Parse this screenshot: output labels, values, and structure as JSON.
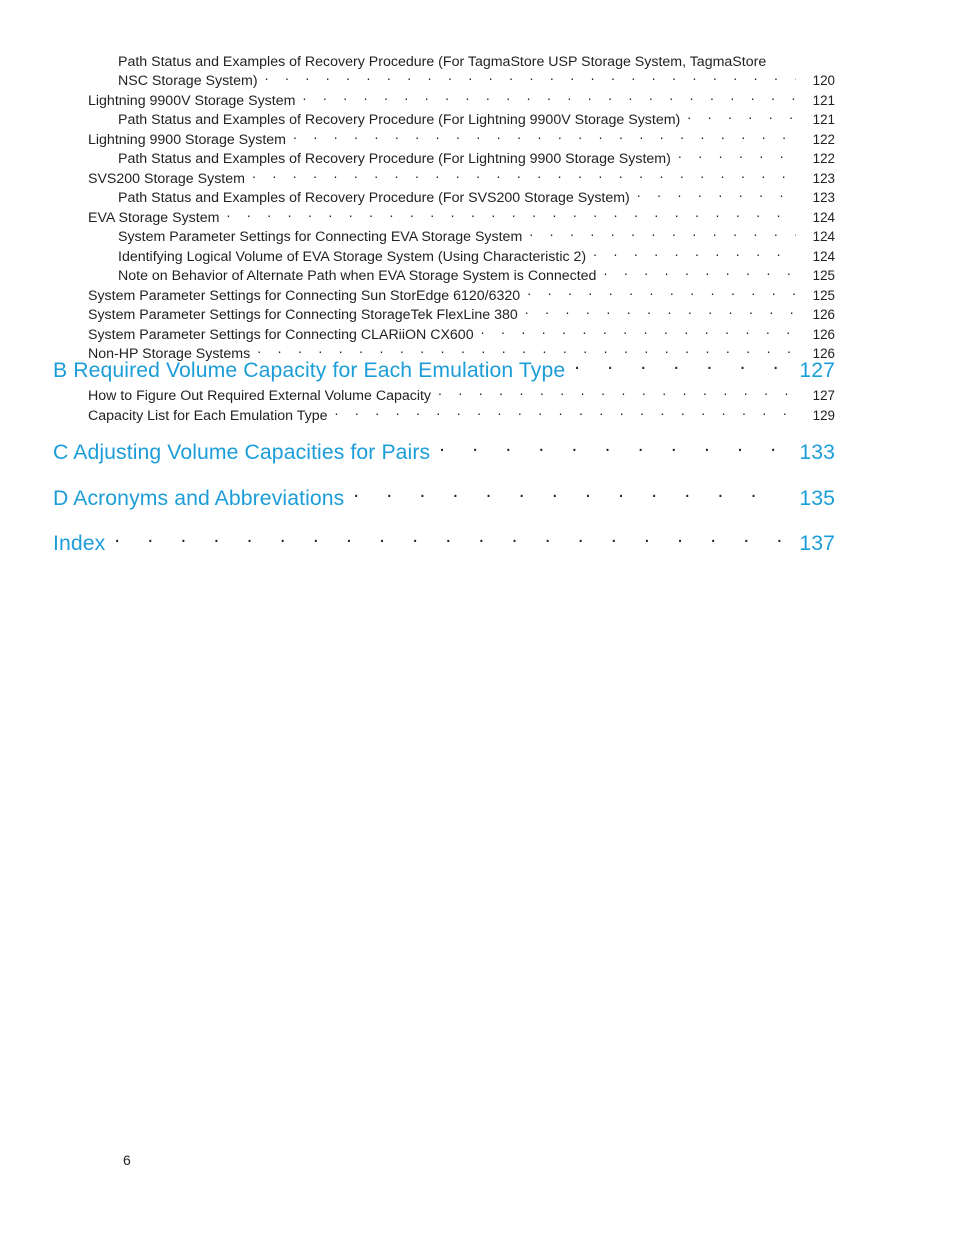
{
  "document": {
    "type": "table-of-contents",
    "footer_page_number": "6",
    "accent_color": "#1b9dd9",
    "text_color": "#221f1f",
    "background_color": "#ffffff"
  },
  "continued_section": {
    "entries": [
      {
        "level": 2,
        "wrapped": true,
        "line1": "Path Status and Examples of Recovery Procedure (For TagmaStore USP Storage System, TagmaStore",
        "title": "NSC Storage System)",
        "page": "120"
      },
      {
        "level": 1,
        "title": "Lightning 9900V Storage System",
        "page": "121"
      },
      {
        "level": 2,
        "title": "Path Status and Examples of Recovery Procedure (For Lightning 9900V Storage System)",
        "page": "121"
      },
      {
        "level": 1,
        "title": "Lightning 9900 Storage System",
        "page": "122"
      },
      {
        "level": 2,
        "title": "Path Status and Examples of Recovery Procedure (For Lightning 9900 Storage System)",
        "page": "122"
      },
      {
        "level": 1,
        "title": "SVS200 Storage System",
        "page": "123"
      },
      {
        "level": 2,
        "title": "Path Status and Examples of Recovery Procedure (For SVS200 Storage System)",
        "page": "123"
      },
      {
        "level": 1,
        "title": "EVA Storage System",
        "page": "124"
      },
      {
        "level": 2,
        "title": "System Parameter Settings for Connecting EVA Storage System",
        "page": "124"
      },
      {
        "level": 2,
        "title": "Identifying Logical Volume of EVA Storage System (Using Characteristic 2)",
        "page": "124"
      },
      {
        "level": 2,
        "title": "Note on Behavior of Alternate Path when EVA Storage System is Connected",
        "page": "125"
      },
      {
        "level": 1,
        "title": "System Parameter Settings for Connecting Sun StorEdge 6120/6320",
        "page": "125"
      },
      {
        "level": 1,
        "title": "System Parameter Settings for Connecting StorageTek FlexLine 380",
        "page": "126"
      },
      {
        "level": 1,
        "title": "System Parameter Settings for Connecting CLARiiON CX600",
        "page": "126"
      },
      {
        "level": 1,
        "title": "Non-HP Storage Systems",
        "page": "126"
      }
    ]
  },
  "chapters": [
    {
      "title": "B Required Volume Capacity for Each Emulation Type",
      "page": "127",
      "subs": [
        {
          "title": "How to Figure Out Required External Volume Capacity",
          "page": "127"
        },
        {
          "title": "Capacity List for Each Emulation Type",
          "page": "129"
        }
      ]
    },
    {
      "title": "C Adjusting Volume Capacities for Pairs",
      "page": "133",
      "subs": []
    },
    {
      "title": "D Acronyms and Abbreviations",
      "page": "135",
      "subs": []
    },
    {
      "title": "Index",
      "page": "137",
      "subs": []
    }
  ]
}
